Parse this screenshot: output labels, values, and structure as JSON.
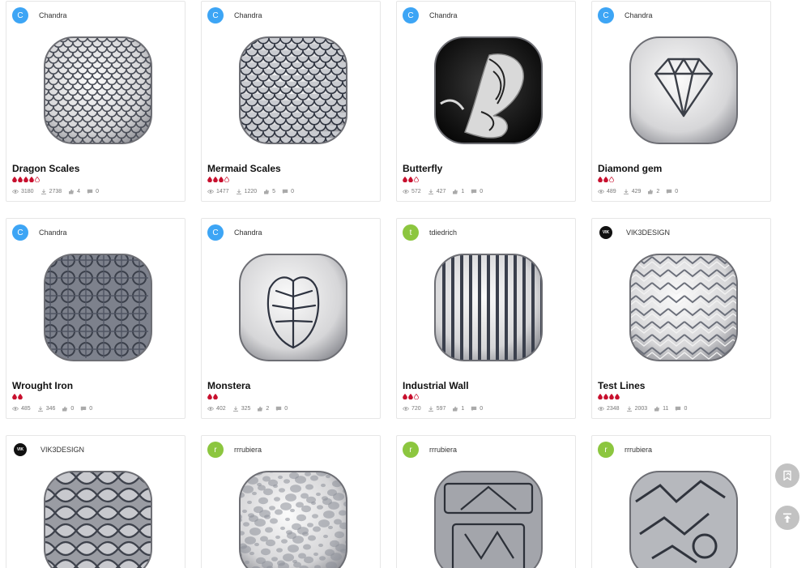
{
  "colors": {
    "avatar_blue": "#3da5f5",
    "avatar_green": "#8cc63f",
    "avatar_black": "#111111",
    "rating_red": "#c8102e",
    "fab_gray": "#c2c2c2"
  },
  "cards": [
    {
      "author": "Chandra",
      "initial": "C",
      "avatar": "blue",
      "title": "Dragon Scales",
      "rating": 4,
      "rating_max": 5,
      "views": "3180",
      "downloads": "2738",
      "likes": "4",
      "comments": "0",
      "pattern": "dragon-scales"
    },
    {
      "author": "Chandra",
      "initial": "C",
      "avatar": "blue",
      "title": "Mermaid Scales",
      "rating": 3,
      "rating_max": 4,
      "views": "1477",
      "downloads": "1220",
      "likes": "5",
      "comments": "0",
      "pattern": "mermaid-scales"
    },
    {
      "author": "Chandra",
      "initial": "C",
      "avatar": "blue",
      "title": "Butterfly",
      "rating": 2,
      "rating_max": 3,
      "views": "572",
      "downloads": "427",
      "likes": "1",
      "comments": "0",
      "pattern": "butterfly"
    },
    {
      "author": "Chandra",
      "initial": "C",
      "avatar": "blue",
      "title": "Diamond gem",
      "rating": 2,
      "rating_max": 3,
      "views": "489",
      "downloads": "429",
      "likes": "2",
      "comments": "0",
      "pattern": "diamond"
    },
    {
      "author": "Chandra",
      "initial": "C",
      "avatar": "blue",
      "title": "Wrought Iron",
      "rating": 2,
      "rating_max": 2,
      "views": "485",
      "downloads": "346",
      "likes": "0",
      "comments": "0",
      "pattern": "wrought-iron"
    },
    {
      "author": "Chandra",
      "initial": "C",
      "avatar": "blue",
      "title": "Monstera",
      "rating": 2,
      "rating_max": 2,
      "views": "402",
      "downloads": "325",
      "likes": "2",
      "comments": "0",
      "pattern": "monstera"
    },
    {
      "author": "tdiedrich",
      "initial": "t",
      "avatar": "green",
      "title": "Industrial Wall",
      "rating": 2,
      "rating_max": 3,
      "views": "720",
      "downloads": "597",
      "likes": "1",
      "comments": "0",
      "pattern": "stripes"
    },
    {
      "author": "VIK3DESIGN",
      "initial": "VIK",
      "avatar": "black",
      "title": "Test Lines",
      "rating": 4,
      "rating_max": 4,
      "views": "2348",
      "downloads": "2003",
      "likes": "11",
      "comments": "0",
      "pattern": "weave"
    },
    {
      "author": "VIK3DESIGN",
      "initial": "VIK",
      "avatar": "black",
      "title": "",
      "rating": 0,
      "rating_max": 0,
      "views": "",
      "downloads": "",
      "likes": "",
      "comments": "",
      "pattern": "waves"
    },
    {
      "author": "rrrubiera",
      "initial": "r",
      "avatar": "green",
      "title": "",
      "rating": 0,
      "rating_max": 0,
      "views": "",
      "downloads": "",
      "likes": "",
      "comments": "",
      "pattern": "noise"
    },
    {
      "author": "rrrubiera",
      "initial": "r",
      "avatar": "green",
      "title": "",
      "rating": 0,
      "rating_max": 0,
      "views": "",
      "downloads": "",
      "likes": "",
      "comments": "",
      "pattern": "carved"
    },
    {
      "author": "rrrubiera",
      "initial": "r",
      "avatar": "green",
      "title": "",
      "rating": 0,
      "rating_max": 0,
      "views": "",
      "downloads": "",
      "likes": "",
      "comments": "",
      "pattern": "tread"
    }
  ],
  "fabs": [
    {
      "icon": "bookmark-icon"
    },
    {
      "icon": "scroll-top-icon"
    }
  ]
}
